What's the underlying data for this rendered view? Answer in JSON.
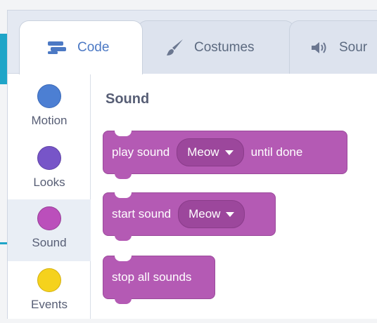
{
  "tabs": [
    {
      "label": "Code",
      "icon": "code-icon",
      "active": true
    },
    {
      "label": "Costumes",
      "icon": "brush-icon",
      "active": false
    },
    {
      "label": "Sour",
      "icon": "speaker-icon",
      "active": false
    }
  ],
  "categories": [
    {
      "label": "Motion",
      "color": "#4c7fd3"
    },
    {
      "label": "Looks",
      "color": "#7755c8"
    },
    {
      "label": "Sound",
      "color": "#bb4fbb",
      "selected": true
    },
    {
      "label": "Events",
      "color": "#f5d21d"
    }
  ],
  "palette": {
    "title": "Sound",
    "blocks": {
      "play": {
        "text_before": "play sound",
        "option": "Meow",
        "text_after": "until done"
      },
      "start": {
        "text_before": "start sound",
        "option": "Meow"
      },
      "stop": {
        "text": "stop all sounds"
      }
    }
  },
  "colors": {
    "sound_block": "#b45ab4",
    "accent": "#1fa5c8",
    "tab_active_text": "#4c79c4"
  }
}
